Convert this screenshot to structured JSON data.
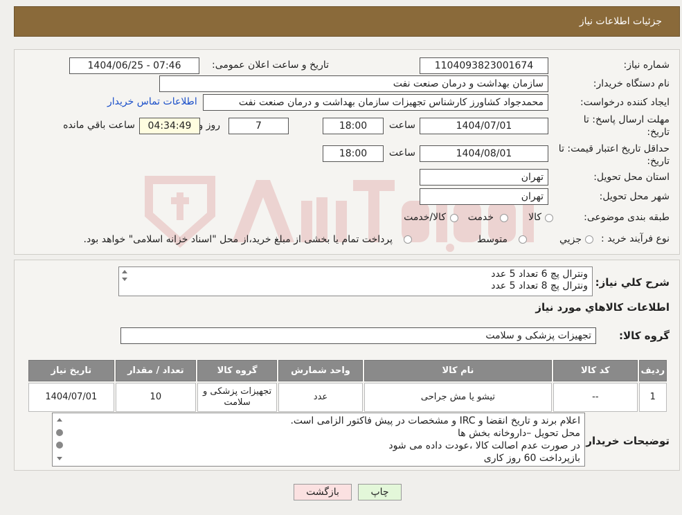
{
  "header": {
    "title": "جزئیات اطلاعات نیاز"
  },
  "form": {
    "need_number_label": "شماره نیاز:",
    "need_number": "1104093823001674",
    "announce_label": "تاریخ و ساعت اعلان عمومی:",
    "announce_value": "1404/06/25 - 07:46",
    "buyer_org_label": "نام دستگاه خریدار:",
    "buyer_org": "سازمان بهداشت و درمان صنعت نفت",
    "creator_label": "ایجاد کننده درخواست:",
    "creator": "محمدجواد کشاورز کارشناس تجهیزات سازمان بهداشت و درمان صنعت نفت",
    "contact_link": "اطلاعات تماس خریدار",
    "deadline_label": "مهلت ارسال پاسخ: تا تاریخ:",
    "deadline_date": "1404/07/01",
    "time_label": "ساعت",
    "deadline_time": "18:00",
    "days_value": "7",
    "days_label": "روز و",
    "remaining_time": "04:34:49",
    "remaining_label": "ساعت باقي مانده",
    "validity_label": "حداقل تاریخ اعتبار قیمت: تا تاریخ:",
    "validity_date": "1404/08/01",
    "validity_time": "18:00",
    "province_label": "استان محل تحویل:",
    "province": "تهران",
    "city_label": "شهر محل تحویل:",
    "city": "تهران",
    "category_label": "طبقه بندی موضوعی:",
    "category_options": [
      "کالا",
      "خدمت",
      "کالا/خدمت"
    ],
    "purchase_type_label": "نوع فرآیند خرید :",
    "purchase_options": [
      "جزيي",
      "متوسط"
    ],
    "purchase_note": "پرداخت تمام یا بخشی از مبلغ خرید،از محل \"اسناد خزانه اسلامی\" خواهد بود."
  },
  "summary": {
    "label": "شرح کلي نیاز:",
    "lines": [
      "ونترال پچ 6 تعداد 5 عدد",
      "ونترال پچ 8 تعداد 5 عدد"
    ]
  },
  "goods": {
    "section_title": "اطلاعات کالاهاي مورد نیاز",
    "group_label": "گروه کالا:",
    "group_value": "تجهیزات پزشکی و سلامت"
  },
  "table": {
    "headers": [
      "رديف",
      "کد کالا",
      "نام کالا",
      "واحد شمارش",
      "گروه کالا",
      "تعداد / مقدار",
      "تاریخ نیاز"
    ],
    "rows": [
      [
        "1",
        "--",
        "تیشو یا مش جراحی",
        "عدد",
        "تجهیزات پزشکی و سلامت",
        "10",
        "1404/07/01"
      ]
    ]
  },
  "buyer_notes": {
    "label": "توضیحات خریدار:",
    "lines": [
      "اعلام برند و تاریخ انقضا  و IRC  و مشخصات در پیش فاکتور الزامی است.",
      "محل تحویل –داروخانه بخش ها",
      "در صورت عدم اصالت کالا ،عودت داده می شود",
      "بازپرداخت 60 روز کاری"
    ]
  },
  "buttons": {
    "print": "چاپ",
    "back": "بازگشت"
  },
  "colors": {
    "header_bg": "#8a6a3a",
    "print_bg": "#e3f7d9",
    "back_bg": "#fbe1e1",
    "link": "#1a4fc9"
  }
}
